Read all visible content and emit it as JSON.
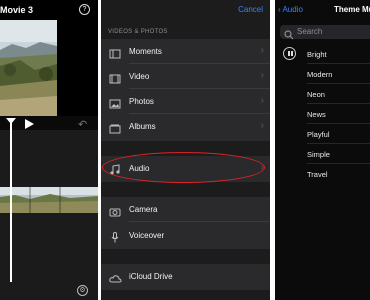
{
  "editor": {
    "title": "Movie 3",
    "help_icon": "question-circle-icon",
    "play_icon": "play-icon",
    "undo_icon": "undo-icon",
    "settings_icon": "gear-icon"
  },
  "picker": {
    "cancel_label": "Cancel",
    "section_label": "VIDEOS & PHOTOS",
    "groups": [
      {
        "items": [
          {
            "label": "Moments",
            "icon": "moments-icon",
            "chevron": "›"
          },
          {
            "label": "Video",
            "icon": "film-icon",
            "chevron": "›"
          },
          {
            "label": "Photos",
            "icon": "photo-icon",
            "chevron": "›"
          },
          {
            "label": "Albums",
            "icon": "album-icon",
            "chevron": "›"
          }
        ]
      },
      {
        "items": [
          {
            "label": "Audio",
            "icon": "music-note-icon",
            "chevron": "›"
          }
        ]
      },
      {
        "items": [
          {
            "label": "Camera",
            "icon": "camera-icon"
          },
          {
            "label": "Voiceover",
            "icon": "microphone-icon"
          }
        ]
      },
      {
        "items": [
          {
            "label": "iCloud Drive",
            "icon": "cloud-icon"
          }
        ]
      }
    ],
    "highlight_color": "#d8242a"
  },
  "theme_music": {
    "back_label": "Audio",
    "title": "Theme Mu",
    "search_placeholder": "Search",
    "items": [
      "Bright",
      "Modern",
      "Neon",
      "News",
      "Playful",
      "Simple",
      "Travel"
    ],
    "playing_index": 0
  },
  "colors": {
    "accent": "#3a82f7",
    "background_dark": "#1c1c1d"
  }
}
